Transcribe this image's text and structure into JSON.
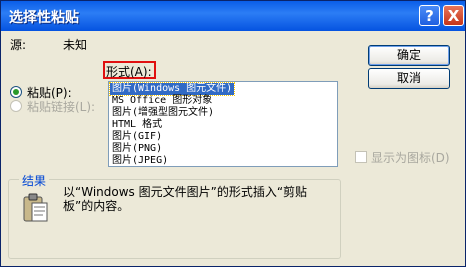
{
  "window": {
    "title": "选择性粘贴"
  },
  "titlebar_buttons": {
    "help": "?",
    "close": "X"
  },
  "source": {
    "label": "源:",
    "value": "未知"
  },
  "format_label": "形式(A):",
  "paste_options": {
    "paste": "粘贴(P):",
    "paste_link": "粘贴链接(L):"
  },
  "formats": [
    "图片(Windows 图元文件)",
    "MS Office 图形对象",
    "图片(增强型图元文件)",
    "HTML 格式",
    "图片(GIF)",
    "图片(PNG)",
    "图片(JPEG)"
  ],
  "buttons": {
    "ok": "确定",
    "cancel": "取消"
  },
  "display_as_icon": "显示为图标(D)",
  "result": {
    "title": "结果",
    "description_line1": "以“Windows 图元文件图片”的形式插入“剪贴",
    "description_line2": "板”的内容。"
  },
  "colors": {
    "titlebar": "#0a5ee8",
    "dialog_bg": "#ece9d8",
    "selection": "#316ac5",
    "highlight_box": "#e01010",
    "group_title": "#0046d5"
  }
}
